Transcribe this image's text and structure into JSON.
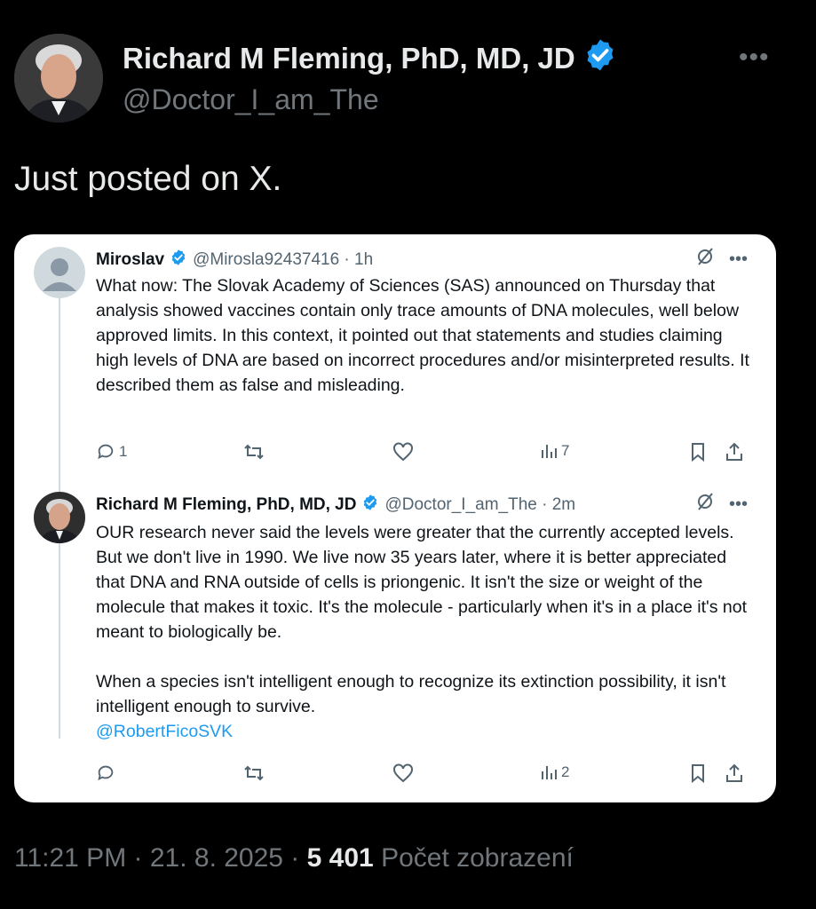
{
  "post": {
    "author_name": "Richard M Fleming, PhD, MD, JD",
    "author_handle": "@Doctor_I_am_The",
    "text": "Just posted on X.",
    "timestamp": "11:21 PM · 21. 8. 2025 ·",
    "views_count": "5 401",
    "views_label": "Počet zobrazení"
  },
  "screenshot": {
    "tweet1": {
      "name": "Miroslav",
      "handle": "@Mirosla92437416 · 1h",
      "text": "What now: The Slovak Academy of Sciences (SAS) announced on Thursday that analysis showed vaccines contain only trace amounts of DNA molecules, well below approved limits. In this context, it pointed out that statements and studies claiming high levels of DNA are based on incorrect procedures and/or misinterpreted results. It described them as false and misleading.",
      "replies": "1",
      "views": "7"
    },
    "tweet2": {
      "name": "Richard M Fleming, PhD, MD, JD",
      "handle": "@Doctor_I_am_The · 2m",
      "text1": "OUR research never said the levels were greater that the currently accepted levels. But we don't live in 1990. We live now 35 years later, where it is better appreciated that DNA and RNA outside of cells is priongenic. It isn't the size or weight of the molecule that makes it toxic. It's the molecule - particularly when it's in a place it's not meant to biologically be.",
      "text2": "When a species isn't intelligent enough to recognize its extinction possibility, it isn't intelligent enough to survive.",
      "mention": "@RobertFicoSVK",
      "views": "2"
    }
  },
  "colors": {
    "accent": "#1d9bf0",
    "muted": "#71767b",
    "background": "#000000"
  }
}
